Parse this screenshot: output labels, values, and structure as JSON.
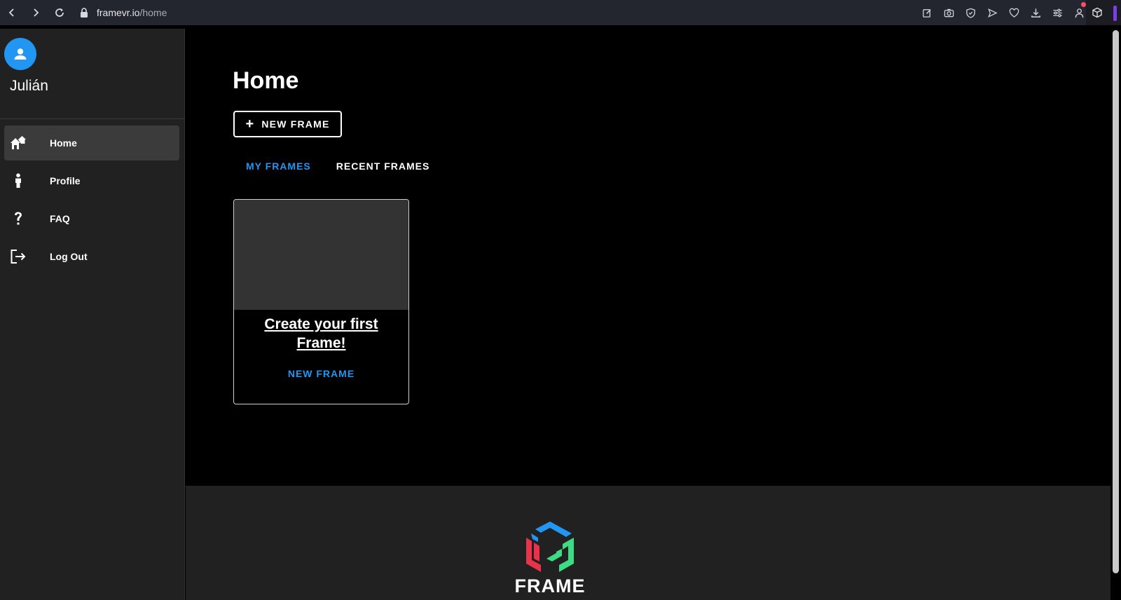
{
  "browser": {
    "url_host": "framevr.io",
    "url_path": "/home"
  },
  "sidebar": {
    "username": "Julián",
    "items": [
      {
        "label": "Home",
        "icon": "home-icon",
        "active": true
      },
      {
        "label": "Profile",
        "icon": "person-icon",
        "active": false
      },
      {
        "label": "FAQ",
        "icon": "question-icon",
        "active": false
      },
      {
        "label": "Log Out",
        "icon": "logout-icon",
        "active": false
      }
    ]
  },
  "main": {
    "title": "Home",
    "new_frame_label": "NEW FRAME",
    "tabs": [
      {
        "label": "MY FRAMES",
        "active": true
      },
      {
        "label": "RECENT FRAMES",
        "active": false
      }
    ],
    "card": {
      "title": "Create your first Frame!",
      "action": "NEW FRAME"
    }
  },
  "footer": {
    "logo_text": "FRAME"
  },
  "colors": {
    "accent": "#2196f3",
    "sidebar_bg": "#212121",
    "logo_blue": "#2196f3",
    "logo_red": "#e8334a",
    "logo_green": "#3ddc84"
  }
}
